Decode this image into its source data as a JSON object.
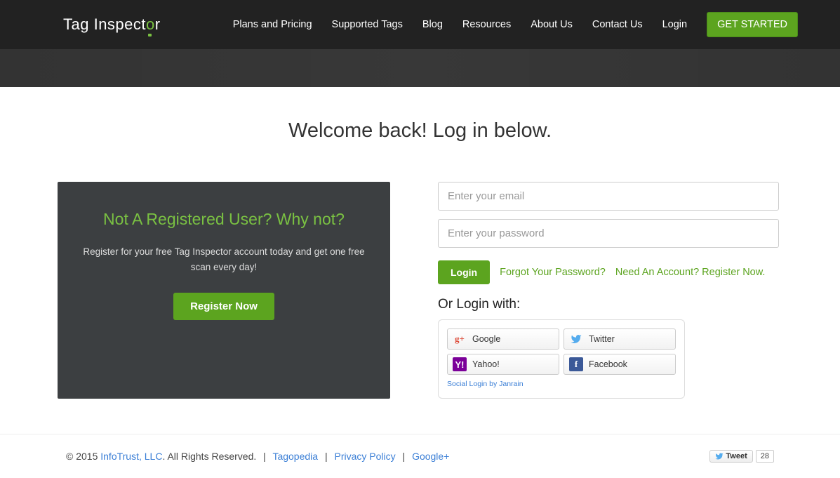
{
  "logo": {
    "part1": "Tag Inspect",
    "accent": "o",
    "part2": "r"
  },
  "nav": {
    "items": [
      "Plans and Pricing",
      "Supported Tags",
      "Blog",
      "Resources",
      "About Us",
      "Contact Us",
      "Login"
    ],
    "cta": "GET STARTED"
  },
  "page_title": "Welcome back! Log in below.",
  "register": {
    "heading": "Not A Registered User? Why not?",
    "body": "Register for your free Tag Inspector account today and get one free scan every day!",
    "button": "Register Now"
  },
  "login": {
    "email_placeholder": "Enter your email",
    "password_placeholder": "Enter your password",
    "button": "Login",
    "forgot": "Forgot Your Password?",
    "need_account": "Need An Account? Register Now."
  },
  "social": {
    "heading": "Or Login with:",
    "providers": [
      "Google",
      "Twitter",
      "Yahoo!",
      "Facebook"
    ],
    "credit": "Social Login by Janrain"
  },
  "footer": {
    "copyright": "© 2015 ",
    "company": "InfoTrust, LLC",
    "rights": ". All Rights Reserved.",
    "links": [
      "Tagopedia",
      "Privacy Policy",
      "Google+"
    ],
    "tweet_label": "Tweet",
    "tweet_count": "28"
  }
}
